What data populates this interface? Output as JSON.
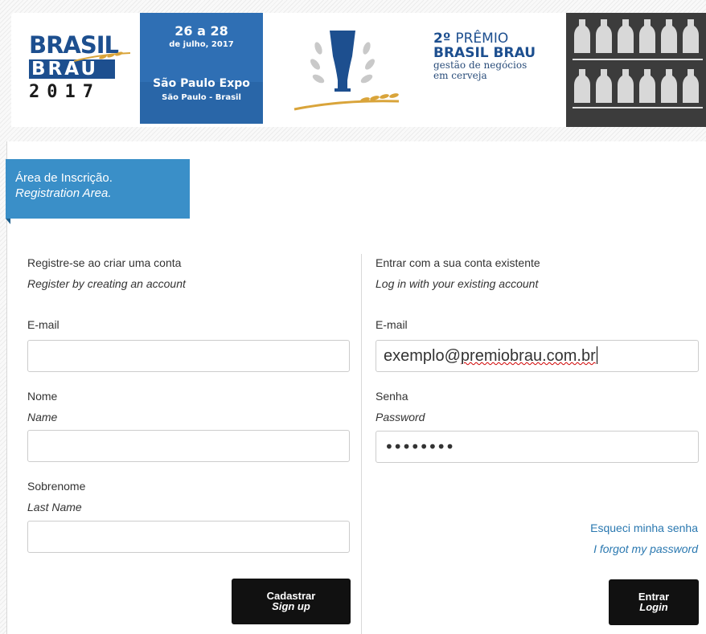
{
  "banner": {
    "logo": {
      "line1": "BRASIL",
      "line2": "BRAU",
      "line3": "2017"
    },
    "event": {
      "dates": "26 a 28",
      "month": "de julho, 2017",
      "venue": "São Paulo Expo",
      "city": "São Paulo - Brasil"
    },
    "award": {
      "edition": "2º",
      "line1_rest": "PRÊMIO",
      "line2": "BRASIL BRAU",
      "line3": "gestão de negócios",
      "line4": "em cerveja"
    },
    "colors": {
      "brand_blue": "#1d4f8f",
      "event_blue": "#2f6fb4",
      "gold": "#d9a43a"
    }
  },
  "area_tab": {
    "title_pt": "Área de Inscrição.",
    "title_en": "Registration Area."
  },
  "register": {
    "heading_pt": "Registre-se ao criar uma conta",
    "heading_en": "Register by creating an account",
    "email_label": "E-mail",
    "email_value": "",
    "name_label_pt": "Nome",
    "name_label_en": "Name",
    "name_value": "",
    "lastname_label_pt": "Sobrenome",
    "lastname_label_en": "Last Name",
    "lastname_value": "",
    "button_pt": "Cadastrar",
    "button_en": "Sign up"
  },
  "login": {
    "heading_pt": "Entrar com a sua conta existente",
    "heading_en": "Log in with your existing account",
    "email_label": "E-mail",
    "email_value_prefix": "exemplo@",
    "email_value_misspelled": "premiobrau.com.br",
    "password_label_pt": "Senha",
    "password_label_en": "Password",
    "password_mask": "••••••••",
    "forgot_pt": "Esqueci minha senha",
    "forgot_en": "I forgot my password",
    "button_pt": "Entrar",
    "button_en": "Login"
  }
}
